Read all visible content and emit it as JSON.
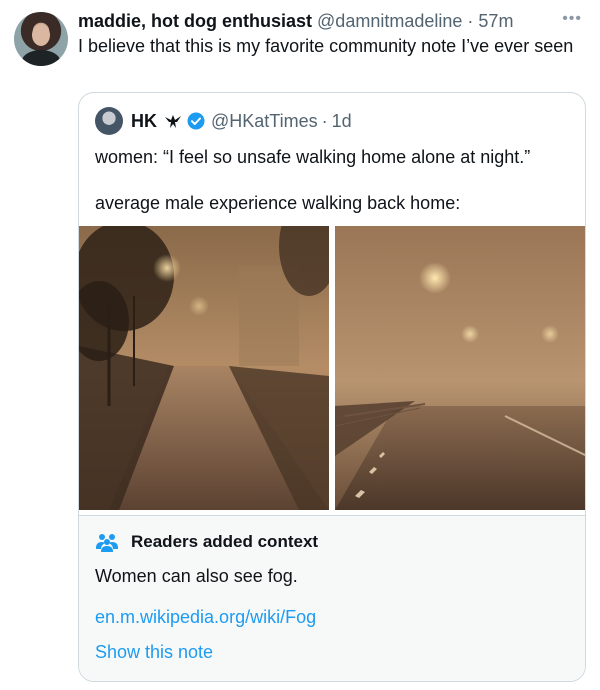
{
  "tweet": {
    "display_name": "maddie, hot dog enthusiast",
    "handle": "@damnitmadeline",
    "separator": "·",
    "time": "57m",
    "more_icon": "more-icon",
    "text": "I believe that this is my favorite community note I’ve ever seen"
  },
  "quote": {
    "display_name": "HK",
    "handle": "@HKatTimes",
    "separator": "·",
    "time": "1d",
    "verified_color": "#1d9bf0",
    "text_line1": "women: “I feel so unsafe walking home alone at night.”",
    "text_line2": "average male experience walking back home:"
  },
  "community_note": {
    "title": "Readers added context",
    "body": "Women can also see fog.",
    "link": "en.m.wikipedia.org/wiki/Fog",
    "show_note": "Show this note",
    "link_color": "#1d9bf0"
  }
}
